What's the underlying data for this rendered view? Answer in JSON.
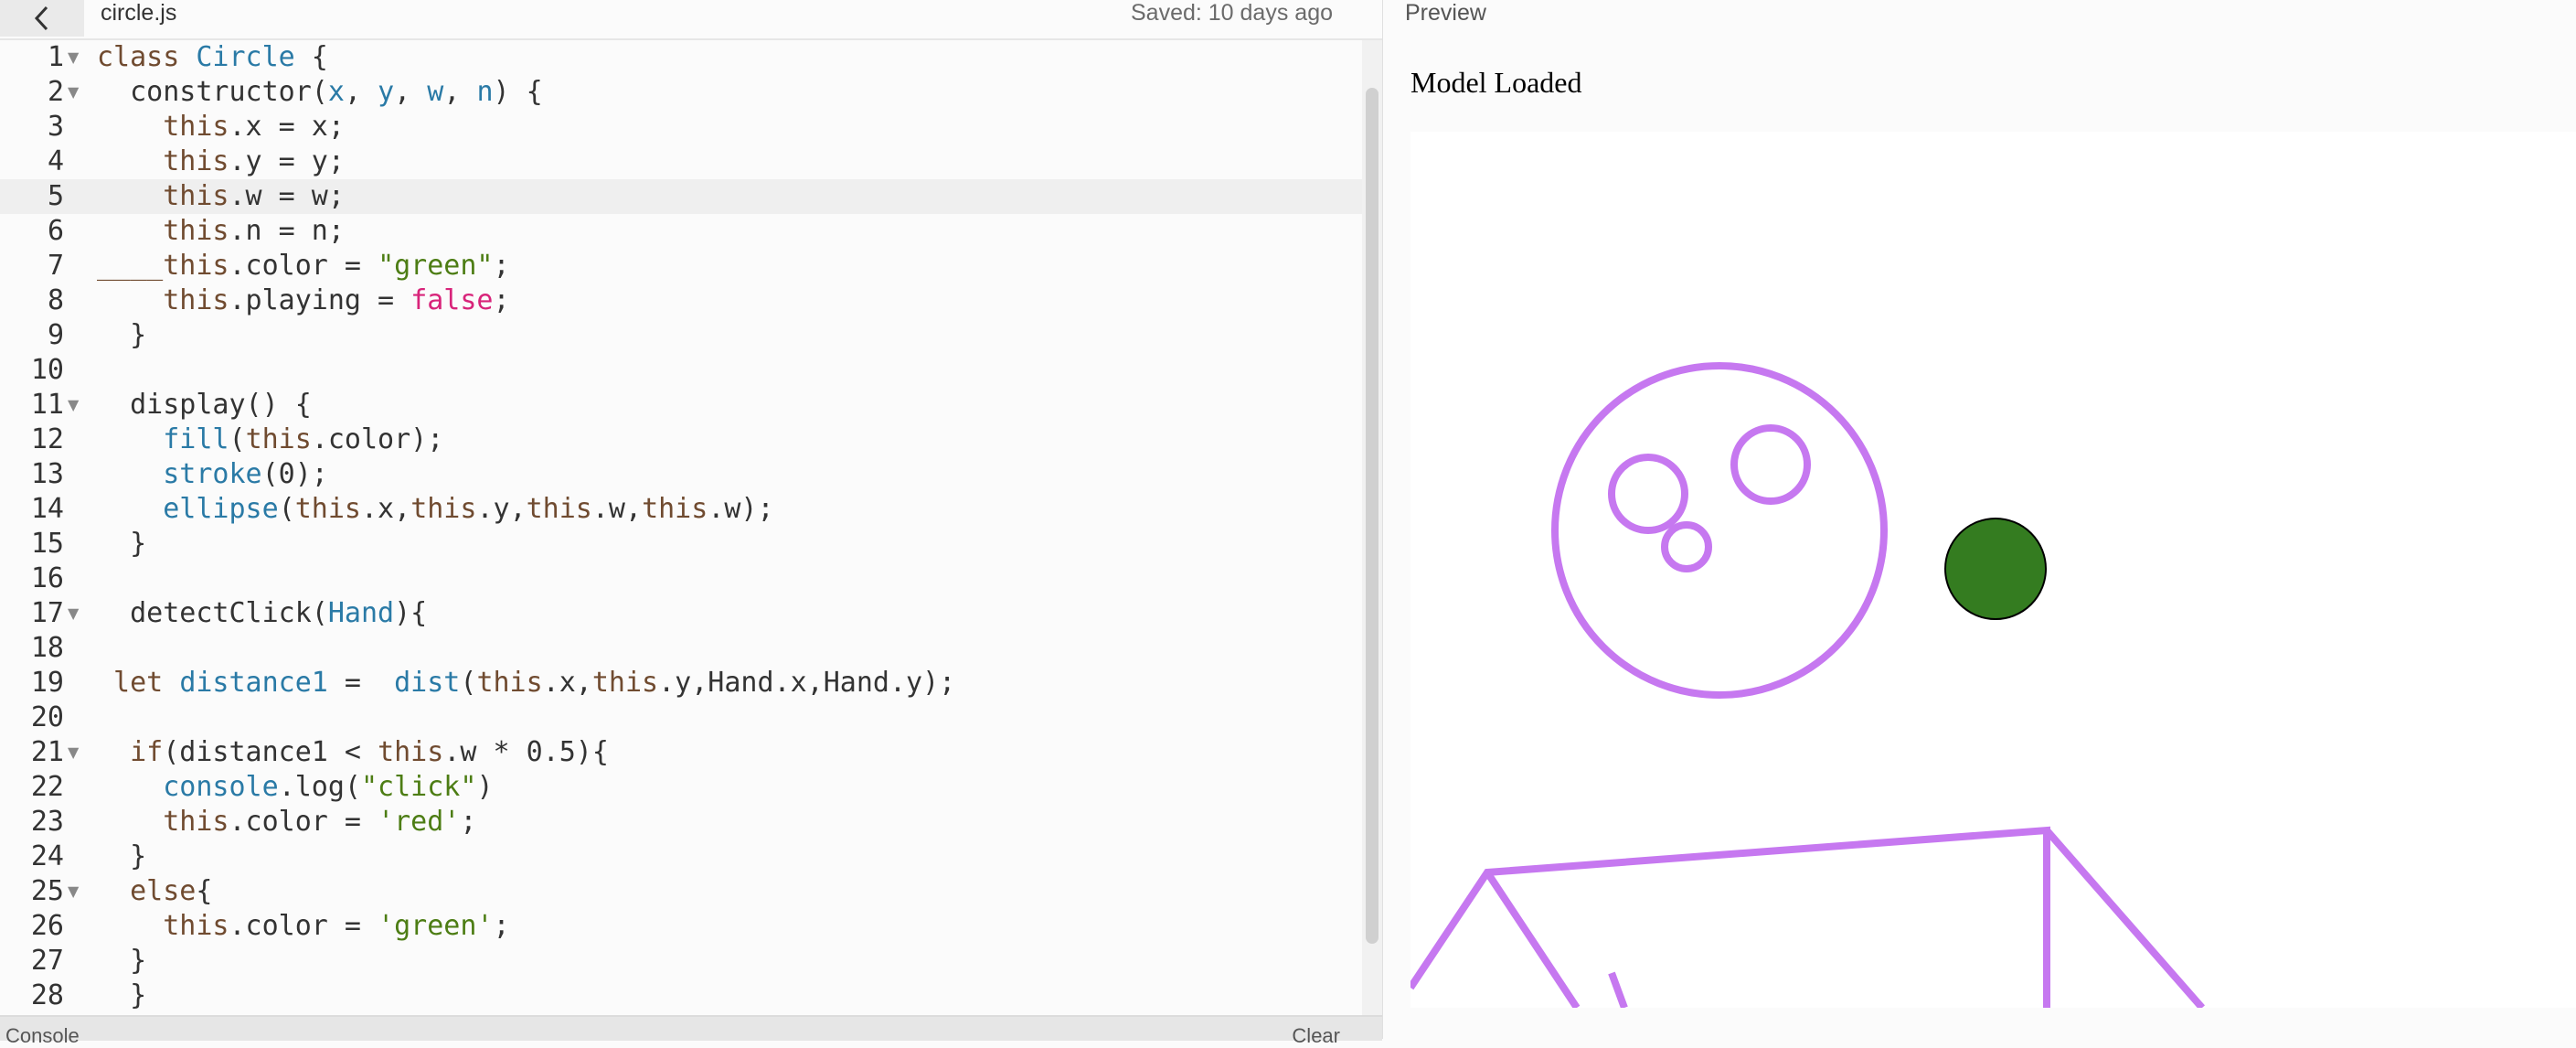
{
  "editor": {
    "file_name": "circle.js",
    "saved_status": "Saved: 10 days ago",
    "code_lines": [
      {
        "n": "1",
        "fold": true,
        "tokens": [
          {
            "t": "class ",
            "c": "keyword"
          },
          {
            "t": "Circle",
            "c": "def"
          },
          {
            "t": " {",
            "c": "op"
          }
        ]
      },
      {
        "n": "2",
        "fold": true,
        "tokens": [
          {
            "t": "  constructor(",
            "c": "op"
          },
          {
            "t": "x",
            "c": "def"
          },
          {
            "t": ", ",
            "c": "op"
          },
          {
            "t": "y",
            "c": "def"
          },
          {
            "t": ", ",
            "c": "op"
          },
          {
            "t": "w",
            "c": "def"
          },
          {
            "t": ", ",
            "c": "op"
          },
          {
            "t": "n",
            "c": "def"
          },
          {
            "t": ") {",
            "c": "op"
          }
        ]
      },
      {
        "n": "3",
        "fold": false,
        "tokens": [
          {
            "t": "    this",
            "c": "keyword"
          },
          {
            "t": ".x = x;",
            "c": "op"
          }
        ]
      },
      {
        "n": "4",
        "fold": false,
        "tokens": [
          {
            "t": "    this",
            "c": "keyword"
          },
          {
            "t": ".y = y;",
            "c": "op"
          }
        ]
      },
      {
        "n": "5",
        "fold": false,
        "active": true,
        "tokens": [
          {
            "t": "    this",
            "c": "keyword"
          },
          {
            "t": ".w = w;",
            "c": "op"
          }
        ]
      },
      {
        "n": "6",
        "fold": false,
        "tokens": [
          {
            "t": "    this",
            "c": "keyword"
          },
          {
            "t": ".n = n;",
            "c": "op"
          }
        ]
      },
      {
        "n": "7",
        "fold": false,
        "tokens": [
          {
            "t": "____this",
            "c": "keyword"
          },
          {
            "t": ".color = ",
            "c": "op"
          },
          {
            "t": "\"green\"",
            "c": "string"
          },
          {
            "t": ";",
            "c": "op"
          }
        ]
      },
      {
        "n": "8",
        "fold": false,
        "tokens": [
          {
            "t": "    this",
            "c": "keyword"
          },
          {
            "t": ".playing = ",
            "c": "op"
          },
          {
            "t": "false",
            "c": "atom"
          },
          {
            "t": ";",
            "c": "op"
          }
        ]
      },
      {
        "n": "9",
        "fold": false,
        "tokens": [
          {
            "t": "  }",
            "c": "op"
          }
        ]
      },
      {
        "n": "10",
        "fold": false,
        "tokens": [
          {
            "t": "",
            "c": "op"
          }
        ]
      },
      {
        "n": "11",
        "fold": true,
        "tokens": [
          {
            "t": "  display() {",
            "c": "op"
          }
        ]
      },
      {
        "n": "12",
        "fold": false,
        "tokens": [
          {
            "t": "    fill",
            "c": "def"
          },
          {
            "t": "(",
            "c": "op"
          },
          {
            "t": "this",
            "c": "keyword"
          },
          {
            "t": ".color);",
            "c": "op"
          }
        ]
      },
      {
        "n": "13",
        "fold": false,
        "tokens": [
          {
            "t": "    stroke",
            "c": "def"
          },
          {
            "t": "(0);",
            "c": "op"
          }
        ]
      },
      {
        "n": "14",
        "fold": false,
        "tokens": [
          {
            "t": "    ellipse",
            "c": "def"
          },
          {
            "t": "(",
            "c": "op"
          },
          {
            "t": "this",
            "c": "keyword"
          },
          {
            "t": ".x,",
            "c": "op"
          },
          {
            "t": "this",
            "c": "keyword"
          },
          {
            "t": ".y,",
            "c": "op"
          },
          {
            "t": "this",
            "c": "keyword"
          },
          {
            "t": ".w,",
            "c": "op"
          },
          {
            "t": "this",
            "c": "keyword"
          },
          {
            "t": ".w);",
            "c": "op"
          }
        ]
      },
      {
        "n": "15",
        "fold": false,
        "tokens": [
          {
            "t": "  }",
            "c": "op"
          }
        ]
      },
      {
        "n": "16",
        "fold": false,
        "tokens": [
          {
            "t": "",
            "c": "op"
          }
        ]
      },
      {
        "n": "17",
        "fold": true,
        "tokens": [
          {
            "t": "  detectClick(",
            "c": "op"
          },
          {
            "t": "Hand",
            "c": "def"
          },
          {
            "t": "){",
            "c": "op"
          }
        ]
      },
      {
        "n": "18",
        "fold": false,
        "tokens": [
          {
            "t": "",
            "c": "op"
          }
        ]
      },
      {
        "n": "19",
        "fold": false,
        "tokens": [
          {
            "t": " let ",
            "c": "keyword"
          },
          {
            "t": "distance1",
            "c": "def"
          },
          {
            "t": " =  ",
            "c": "op"
          },
          {
            "t": "dist",
            "c": "def"
          },
          {
            "t": "(",
            "c": "op"
          },
          {
            "t": "this",
            "c": "keyword"
          },
          {
            "t": ".x,",
            "c": "op"
          },
          {
            "t": "this",
            "c": "keyword"
          },
          {
            "t": ".y,Hand.x,Hand.y);",
            "c": "op"
          }
        ]
      },
      {
        "n": "20",
        "fold": false,
        "tokens": [
          {
            "t": "",
            "c": "op"
          }
        ]
      },
      {
        "n": "21",
        "fold": true,
        "tokens": [
          {
            "t": "  if",
            "c": "keyword"
          },
          {
            "t": "(distance1 < ",
            "c": "op"
          },
          {
            "t": "this",
            "c": "keyword"
          },
          {
            "t": ".w * 0.5){",
            "c": "op"
          }
        ]
      },
      {
        "n": "22",
        "fold": false,
        "tokens": [
          {
            "t": "    console",
            "c": "def"
          },
          {
            "t": ".log(",
            "c": "op"
          },
          {
            "t": "\"click\"",
            "c": "string"
          },
          {
            "t": ")",
            "c": "op"
          }
        ]
      },
      {
        "n": "23",
        "fold": false,
        "tokens": [
          {
            "t": "    this",
            "c": "keyword"
          },
          {
            "t": ".color = ",
            "c": "op"
          },
          {
            "t": "'red'",
            "c": "string"
          },
          {
            "t": ";",
            "c": "op"
          }
        ]
      },
      {
        "n": "24",
        "fold": false,
        "tokens": [
          {
            "t": "  }",
            "c": "op"
          }
        ]
      },
      {
        "n": "25",
        "fold": true,
        "tokens": [
          {
            "t": "  else",
            "c": "keyword"
          },
          {
            "t": "{",
            "c": "op"
          }
        ]
      },
      {
        "n": "26",
        "fold": false,
        "tokens": [
          {
            "t": "    this",
            "c": "keyword"
          },
          {
            "t": ".color = ",
            "c": "op"
          },
          {
            "t": "'green'",
            "c": "string"
          },
          {
            "t": ";",
            "c": "op"
          }
        ]
      },
      {
        "n": "27",
        "fold": false,
        "tokens": [
          {
            "t": "  }",
            "c": "op"
          }
        ]
      },
      {
        "n": "28",
        "fold": false,
        "tokens": [
          {
            "t": "  }",
            "c": "op"
          }
        ]
      }
    ]
  },
  "console": {
    "title": "Console",
    "clear_label": "Clear"
  },
  "preview": {
    "header": "Preview",
    "model_status": "Model Loaded",
    "sketch": {
      "hand_color": "#c678f0",
      "circle_fill": "#347c20",
      "circle_stroke": "#000000"
    }
  },
  "colors": {
    "keyword": "#704b30",
    "def": "#2a7aa6",
    "string": "#4d7d14",
    "atom": "#d8247a"
  },
  "icons": {
    "back": "chevron-left-icon",
    "fold": "fold-triangle-icon"
  }
}
